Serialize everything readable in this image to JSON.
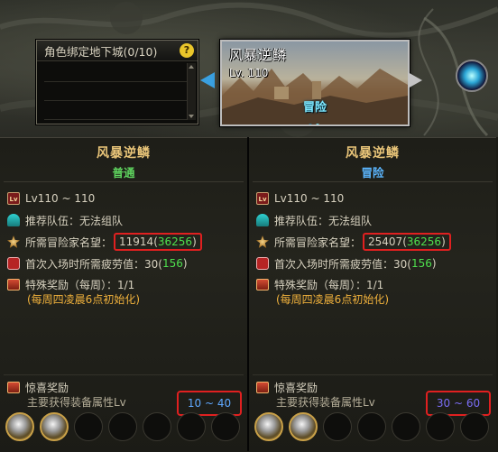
{
  "dungeon_list": {
    "title": "角色绑定地下城(0/10)",
    "help_icon": "question-mark-icon",
    "help_glyph": "?"
  },
  "dungeon_card": {
    "name": "风暴逆鳞",
    "level": "Lv. 110",
    "mode": "冒险"
  },
  "columns": [
    {
      "title": "风暴逆鳞",
      "difficulty": "普通",
      "level_range": "Lv110 ~ 110",
      "party_label": "推荐队伍：无法组队",
      "fame_label": "所需冒险家名望：",
      "fame_required": "11914",
      "fame_bracket_open": "(",
      "fame_recommended": "36256",
      "fame_bracket_close": ")",
      "fatigue_label": "首次入场时所需疲劳值：30(",
      "fatigue_value": "156",
      "fatigue_close": ")",
      "reward_label": "特殊奖励（每周）：1/1",
      "reset_note": "(每周四凌晨6点初始化)",
      "surprise_title": "惊喜奖励",
      "surprise_desc": "主要获得装备属性Lv",
      "surprise_range": "10 ~ 40"
    },
    {
      "title": "风暴逆鳞",
      "difficulty": "冒险",
      "level_range": "Lv110 ~ 110",
      "party_label": "推荐队伍：无法组队",
      "fame_label": "所需冒险家名望：",
      "fame_required": "25407",
      "fame_bracket_open": "(",
      "fame_recommended": "36256",
      "fame_bracket_close": ")",
      "fatigue_label": "首次入场时所需疲劳值：30(",
      "fatigue_value": "156",
      "fatigue_close": ")",
      "reward_label": "特殊奖励（每周）：1/1",
      "reset_note": "(每周四凌晨6点初始化)",
      "surprise_title": "惊喜奖励",
      "surprise_desc": "主要获得装备属性Lv",
      "surprise_range": "30 ~ 60"
    }
  ],
  "colors": {
    "title_gold": "#e9c579",
    "normal_green": "#5fd55f",
    "adventure_blue": "#5bb6ff",
    "highlight_red": "#e02020",
    "note_orange": "#f0b13c"
  }
}
